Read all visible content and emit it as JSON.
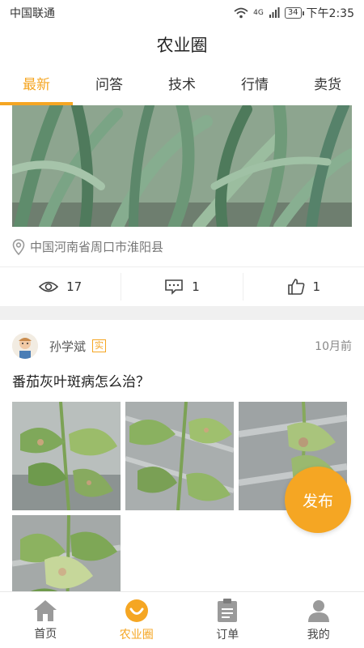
{
  "status": {
    "carrier": "中国联通",
    "network": "4G",
    "battery": "34",
    "time": "下午2:35"
  },
  "header": {
    "title": "农业圈"
  },
  "tabs": [
    {
      "label": "最新",
      "active": true
    },
    {
      "label": "问答",
      "active": false
    },
    {
      "label": "技术",
      "active": false
    },
    {
      "label": "行情",
      "active": false
    },
    {
      "label": "卖货",
      "active": false
    }
  ],
  "post1": {
    "location": "中国河南省周口市淮阳县",
    "views": "17",
    "comments": "1",
    "likes": "1"
  },
  "post2": {
    "author": "孙学斌",
    "badge": "实",
    "time": "10月前",
    "title": "番茄灰叶斑病怎么治？",
    "images": 4
  },
  "fab": {
    "label": "发布"
  },
  "bottom_nav": [
    {
      "label": "首页",
      "icon": "home-icon",
      "active": false
    },
    {
      "label": "农业圈",
      "icon": "circle-smile-icon",
      "active": true
    },
    {
      "label": "订单",
      "icon": "clipboard-icon",
      "active": false
    },
    {
      "label": "我的",
      "icon": "person-icon",
      "active": false
    }
  ],
  "colors": {
    "accent": "#F5A623",
    "icon_gray": "#9a9a9a"
  }
}
